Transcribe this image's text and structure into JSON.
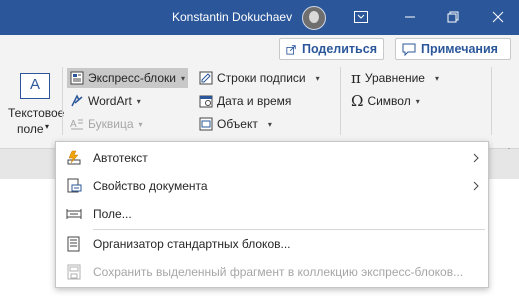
{
  "titlebar": {
    "user_name": "Konstantin Dokuchaev",
    "controls": [
      "ribbon-display-options-icon",
      "minimize-icon",
      "restore-icon",
      "close-icon"
    ]
  },
  "ribbon": {
    "share_label": "Поделиться",
    "comments_label": "Примечания",
    "textbox_label_line1": "Текстовое",
    "textbox_label_line2": "поле",
    "quick_parts_label": "Экспресс-блоки",
    "wordart_label": "WordArt",
    "dropcap_label": "Буквица",
    "signature_line_label": "Строки подписи",
    "date_time_label": "Дата и время",
    "object_label": "Объект",
    "equation_label": "Уравнение",
    "symbol_label": "Символ"
  },
  "menu": {
    "items": [
      {
        "label": "Автотекст",
        "icon": "autotext-icon",
        "submenu": true,
        "disabled": false
      },
      {
        "label": "Свойство документа",
        "icon": "document-property-icon",
        "submenu": true,
        "disabled": false
      },
      {
        "label": "Поле...",
        "icon": "field-icon",
        "submenu": false,
        "disabled": false
      },
      {
        "label": "Организатор стандартных блоков...",
        "icon": "building-blocks-organizer-icon",
        "submenu": false,
        "disabled": false
      },
      {
        "label": "Сохранить выделенный фрагмент в коллекцию экспресс-блоков...",
        "icon": "save-selection-icon",
        "submenu": false,
        "disabled": true
      }
    ]
  },
  "colors": {
    "titlebar": "#2b579a",
    "accent": "#2b579a",
    "ribbon_bg": "#f3f3f3",
    "disabled_text": "#a6a6a6"
  }
}
